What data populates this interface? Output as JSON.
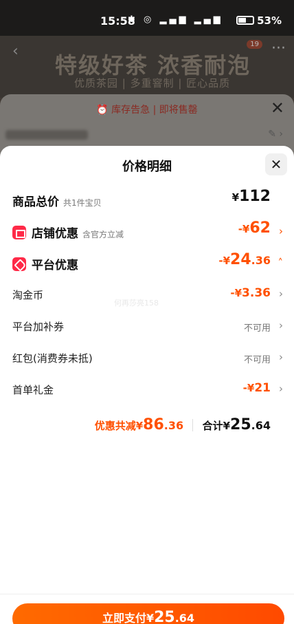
{
  "status_bar": {
    "time": "15:58",
    "battery": "53%",
    "signal": "4G 5G"
  },
  "banner": {
    "title": "特级好茶  浓香耐泡",
    "subtitle": "优质茶园 | 多重窨制 | 匠心品质",
    "cart_badge": "19"
  },
  "notice": {
    "text": "⏰ 库存告急 | 即将售罄"
  },
  "sheet": {
    "title": "价格明细",
    "rows": [
      {
        "label": "商品总价",
        "sub": "共1件宝贝",
        "value_cur": "¥",
        "value": "112",
        "value_dec": ""
      },
      {
        "label": "店铺优惠",
        "sub": "含官方立减",
        "value_cur": "-¥",
        "value": "62",
        "value_dec": ""
      },
      {
        "label": "平台优惠",
        "sub": "",
        "value_cur": "-¥",
        "value": "24",
        "value_dec": ".36"
      },
      {
        "label": "淘金币",
        "value_cur": "-¥",
        "value": "3",
        "value_dec": ".36"
      },
      {
        "label": "平台加补券",
        "value": "不可用"
      },
      {
        "label": "红包(消费券未抵)",
        "value": "不可用"
      },
      {
        "label": "首单礼金",
        "value_cur": "-¥",
        "value": "21",
        "value_dec": ""
      }
    ],
    "watermark": "何再莎亮158",
    "summary": {
      "discount_label": "优惠共减¥",
      "discount_int": "86",
      "discount_dec": ".36",
      "total_label": "合计¥",
      "total_int": "25",
      "total_dec": ".64"
    }
  },
  "pay": {
    "label": "立即支付¥",
    "int": "25",
    "dec": ".64"
  },
  "colors": {
    "accent": "#ff5000",
    "brand_red": "#ff2a48"
  }
}
